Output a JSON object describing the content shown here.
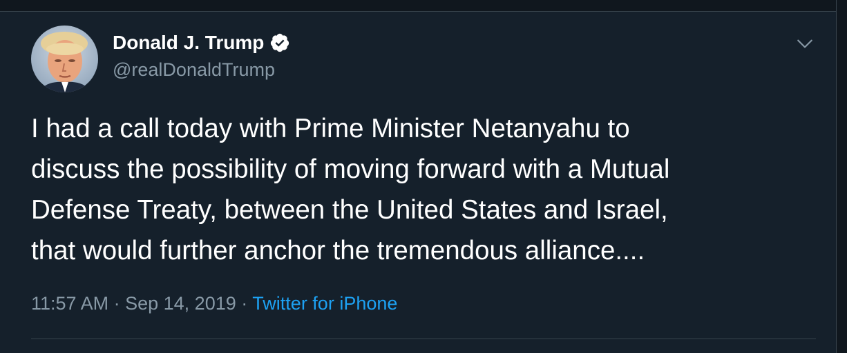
{
  "tweet": {
    "author": {
      "display_name": "Donald J. Trump",
      "handle": "@realDonaldTrump",
      "verified": true,
      "avatar_icon": "profile-photo"
    },
    "text_lines": [
      "I had a call today with Prime Minister Netanyahu to",
      "discuss the possibility of moving forward with a Mutual",
      "Defense Treaty, between the United States and Israel,",
      "that would further anchor the tremendous alliance...."
    ],
    "time": "11:57 AM",
    "separator": "·",
    "date": "Sep 14, 2019",
    "source": "Twitter for iPhone",
    "menu_icon": "chevron-down-icon"
  },
  "colors": {
    "background": "#15202b",
    "text": "#ffffff",
    "secondary_text": "#8899a6",
    "link": "#1da1f2",
    "border": "#38444d"
  }
}
